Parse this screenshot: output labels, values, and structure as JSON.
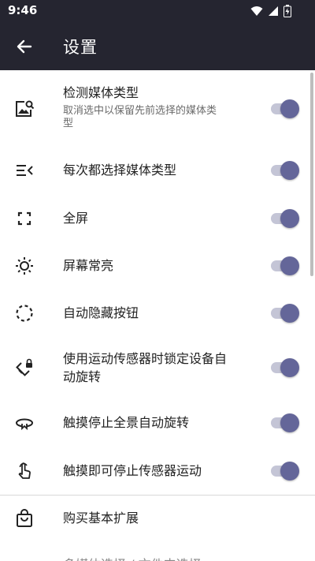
{
  "status": {
    "time": "9:46"
  },
  "appbar": {
    "title": "设置"
  },
  "settings": {
    "detect_media_type": {
      "label": "检测媒体类型",
      "sub1": "取消选中以保留先前选择的媒体类",
      "sub2": "型",
      "toggle_on": true
    },
    "choose_media_type": {
      "label": "每次都选择媒体类型",
      "toggle_on": true
    },
    "fullscreen": {
      "label": "全屏",
      "toggle_on": true
    },
    "screen_on": {
      "label": "屏幕常亮",
      "toggle_on": true
    },
    "auto_hide_buttons": {
      "label": "自动隐藏按钮",
      "toggle_on": true
    },
    "lock_rotation": {
      "label1": "使用运动传感器时锁定设备自",
      "label2": "动旋转",
      "toggle_on": true
    },
    "stop_auto_rotate": {
      "label": "触摸停止全景自动旋转",
      "toggle_on": true
    },
    "stop_sensor_motion": {
      "label": "触摸即可停止传感器运动",
      "toggle_on": true
    },
    "buy_extension": {
      "label": "购买基本扩展"
    },
    "partial_next": {
      "label": "多媒体选择 / 文件夹选择"
    }
  },
  "colors": {
    "appbar": "#252530",
    "thumb": "#646699",
    "track": "#c4c5d6"
  }
}
